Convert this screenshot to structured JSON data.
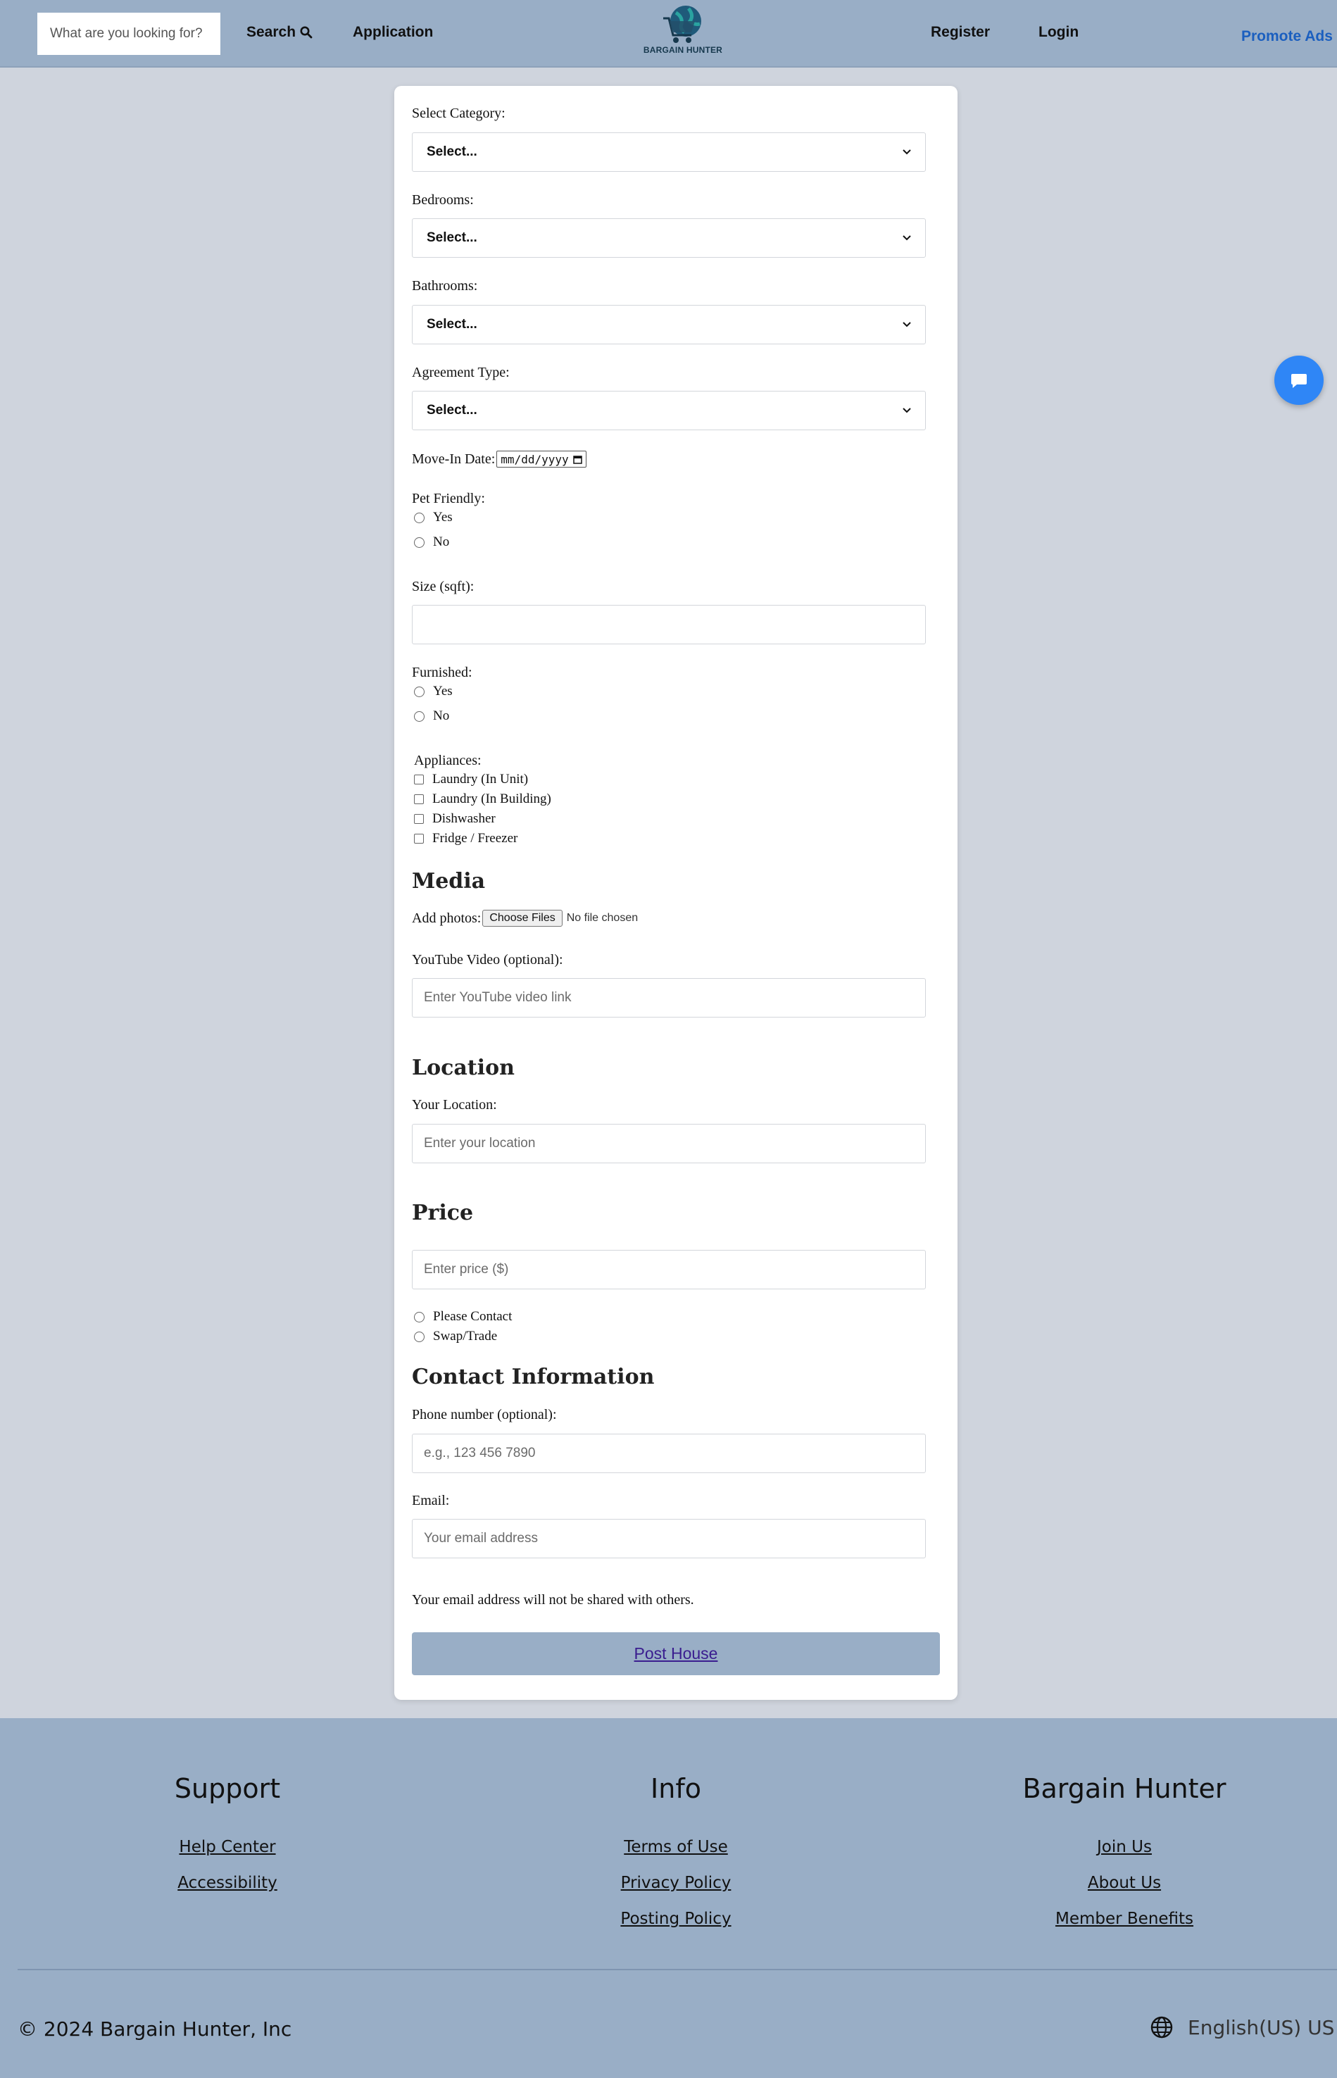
{
  "header": {
    "search_placeholder": "What are you looking for?",
    "search_label": "Search",
    "application_label": "Application",
    "logo_text": "BARGAIN HUNTER",
    "register_label": "Register",
    "login_label": "Login",
    "promote_label": "Promote Ads"
  },
  "form": {
    "category": {
      "label": "Select Category:",
      "value": "Select..."
    },
    "bedrooms": {
      "label": "Bedrooms:",
      "value": "Select..."
    },
    "bathrooms": {
      "label": "Bathrooms:",
      "value": "Select..."
    },
    "agreement": {
      "label": "Agreement Type:",
      "value": "Select..."
    },
    "move_in": {
      "label": "Move-In Date:",
      "placeholder": "mm/dd/yyyy"
    },
    "pet_friendly": {
      "label": "Pet Friendly:",
      "options": [
        "Yes",
        "No"
      ]
    },
    "size": {
      "label": "Size (sqft):",
      "value": ""
    },
    "furnished": {
      "label": "Furnished:",
      "options": [
        "Yes",
        "No"
      ]
    },
    "appliances": {
      "label": "Appliances:",
      "options": [
        "Laundry (In Unit)",
        "Laundry (In Building)",
        "Dishwasher",
        "Fridge / Freezer"
      ]
    },
    "media": {
      "heading": "Media",
      "photos_label": "Add photos:",
      "choose_files": "Choose Files",
      "file_status": "No file chosen",
      "youtube_label": "YouTube Video (optional):",
      "youtube_placeholder": "Enter YouTube video link"
    },
    "location": {
      "heading": "Location",
      "label": "Your Location:",
      "placeholder": "Enter your location"
    },
    "price": {
      "heading": "Price",
      "placeholder": "Enter price ($)",
      "options": [
        "Please Contact",
        "Swap/Trade"
      ]
    },
    "contact": {
      "heading": "Contact Information",
      "phone_label": "Phone number (optional):",
      "phone_placeholder": "e.g., 123 456 7890",
      "email_label": "Email:",
      "email_placeholder": "Your email address",
      "privacy_note": "Your email address will not be shared with others."
    },
    "submit_label": "Post House"
  },
  "footer": {
    "support": {
      "heading": "Support",
      "links": [
        "Help Center",
        "Accessibility"
      ]
    },
    "info": {
      "heading": "Info",
      "links": [
        "Terms of Use",
        "Privacy Policy",
        "Posting Policy"
      ]
    },
    "brand": {
      "heading": "Bargain Hunter",
      "links": [
        "Join Us",
        "About Us",
        "Member Benefits"
      ]
    },
    "copyright": "© 2024 Bargain Hunter, Inc",
    "language": "English(US) US $"
  },
  "colors": {
    "header_bg": "#99aec6",
    "page_bg": "#cfd4dd",
    "accent_blue": "#2f86f6",
    "promote_text": "#1b5fbf"
  }
}
